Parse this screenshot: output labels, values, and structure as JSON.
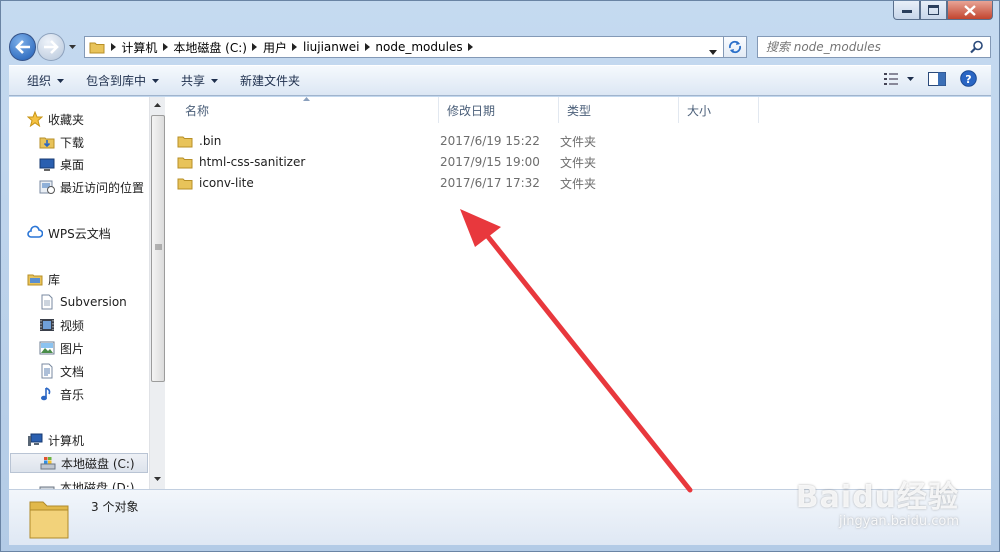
{
  "address": {
    "crumbs": [
      "计算机",
      "本地磁盘 (C:)",
      "用户",
      "liujianwei",
      "node_modules"
    ],
    "search_placeholder": "搜索 node_modules"
  },
  "toolbar": {
    "organize": "组织",
    "include_library": "包含到库中",
    "share": "共享",
    "new_folder": "新建文件夹"
  },
  "nav": {
    "favorites": "收藏夹",
    "downloads": "下载",
    "desktop": "桌面",
    "recent": "最近访问的位置",
    "wps": "WPS云文档",
    "libraries": "库",
    "subversion": "Subversion",
    "videos": "视频",
    "pictures": "图片",
    "documents": "文档",
    "music": "音乐",
    "computer": "计算机",
    "drive_c": "本地磁盘 (C:)",
    "drive_d": "本地磁盘 (D:)"
  },
  "columns": {
    "name": "名称",
    "date": "修改日期",
    "type": "类型",
    "size": "大小"
  },
  "files": [
    {
      "name": ".bin",
      "date": "2017/6/19 15:22",
      "type": "文件夹"
    },
    {
      "name": "html-css-sanitizer",
      "date": "2017/9/15 19:00",
      "type": "文件夹"
    },
    {
      "name": "iconv-lite",
      "date": "2017/6/17 17:32",
      "type": "文件夹"
    }
  ],
  "status": "3 个对象",
  "watermark": {
    "brand": "Baidu经验",
    "url": "jingyan.baidu.com"
  },
  "colors": {
    "annotation_arrow": "#e8383d",
    "folder": "#e8c35a"
  }
}
